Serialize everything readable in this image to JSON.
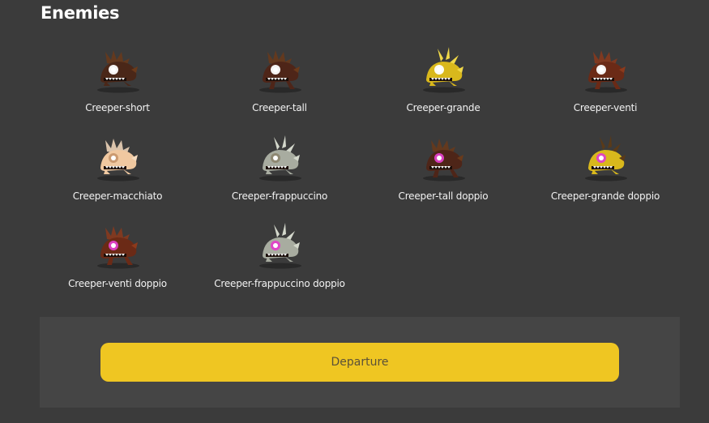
{
  "section_title": "Enemies",
  "enemies": [
    {
      "label": "Creeper-short",
      "sprite": "creeper-short-sprite",
      "body": "#4a2718",
      "accent": "#6b3a1a",
      "eye": "#ffffff",
      "variant": "short"
    },
    {
      "label": "Creeper-tall",
      "sprite": "creeper-tall-sprite",
      "body": "#4e2518",
      "accent": "#6b3a1a",
      "eye": "#ffffff",
      "variant": "tall"
    },
    {
      "label": "Creeper-grande",
      "sprite": "creeper-grande-sprite",
      "body": "#d9b81c",
      "accent": "#f0d848",
      "eye": "#ffffff",
      "variant": "grande"
    },
    {
      "label": "Creeper-venti",
      "sprite": "creeper-venti-sprite",
      "body": "#6b2a16",
      "accent": "#8c3a1c",
      "eye": "#ffffff",
      "variant": "venti"
    },
    {
      "label": "Creeper-macchiato",
      "sprite": "creeper-macchiato-sprite",
      "body": "#f0c8a0",
      "accent": "#f7dcc0",
      "eye": "#c8986e",
      "variant": "short"
    },
    {
      "label": "Creeper-frappuccino",
      "sprite": "creeper-frappuccino-sprite",
      "body": "#a8aca0",
      "accent": "#d4d8cc",
      "eye": "#8c8670",
      "variant": "grande"
    },
    {
      "label": "Creeper-tall doppio",
      "sprite": "creeper-tall-doppio-sprite",
      "body": "#4e2518",
      "accent": "#6b3a1a",
      "eye": "#e040c8",
      "variant": "tall"
    },
    {
      "label": "Creeper-grande doppio",
      "sprite": "creeper-grande-doppio-sprite",
      "body": "#d9b81c",
      "accent": "#5a3a18",
      "eye": "#e040c8",
      "variant": "grande"
    },
    {
      "label": "Creeper-venti doppio",
      "sprite": "creeper-venti-doppio-sprite",
      "body": "#6b2a16",
      "accent": "#8c3a1c",
      "eye": "#e040c8",
      "variant": "venti"
    },
    {
      "label": "Creeper-frappuccino doppio",
      "sprite": "creeper-frappuccino-doppio-sprite",
      "body": "#a8aca0",
      "accent": "#d4d8cc",
      "eye": "#e040c8",
      "variant": "grande"
    }
  ],
  "departure_button": "Departure",
  "colors": {
    "background": "#3b3b3b",
    "panel": "#454545",
    "button": "#efc622",
    "button_text": "#5b5138"
  }
}
